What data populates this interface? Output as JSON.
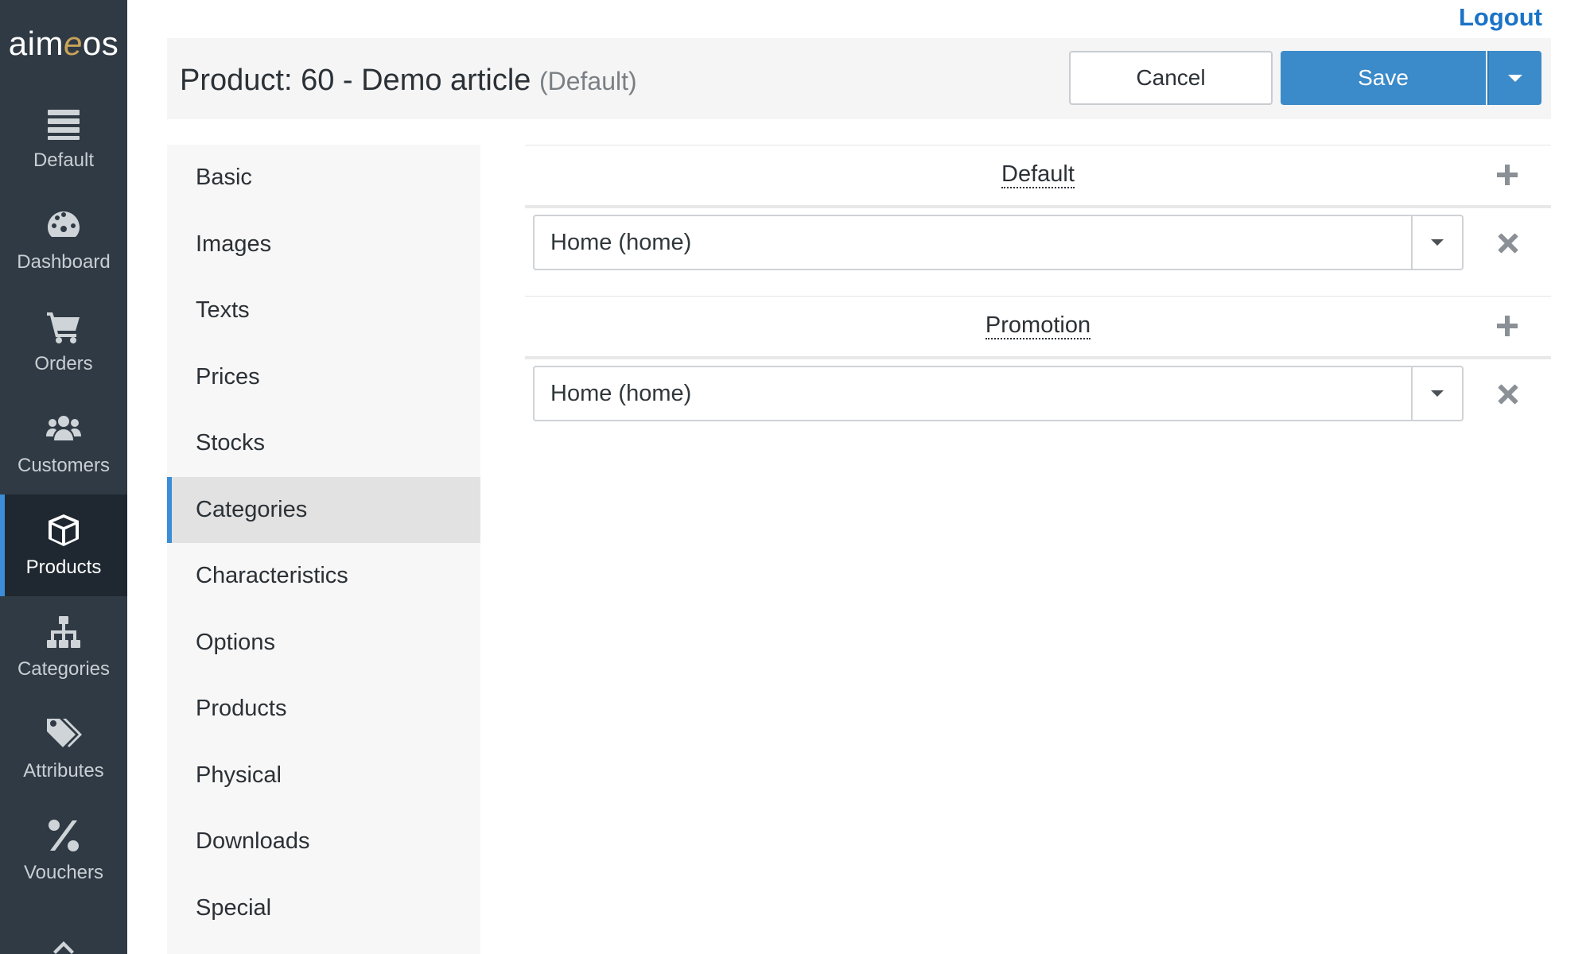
{
  "brand": {
    "logo_pre": "aim",
    "logo_e": "e",
    "logo_post": "os"
  },
  "sidebar": {
    "items": [
      {
        "label": "Default",
        "icon": "server-icon"
      },
      {
        "label": "Dashboard",
        "icon": "dashboard-icon"
      },
      {
        "label": "Orders",
        "icon": "cart-icon"
      },
      {
        "label": "Customers",
        "icon": "users-icon"
      },
      {
        "label": "Products",
        "icon": "box-icon",
        "active": true
      },
      {
        "label": "Categories",
        "icon": "sitemap-icon"
      },
      {
        "label": "Attributes",
        "icon": "tags-icon"
      },
      {
        "label": "Vouchers",
        "icon": "percent-icon"
      }
    ]
  },
  "topbar": {
    "logout_label": "Logout"
  },
  "header": {
    "title": "Product: 60 - Demo article",
    "site": "(Default)",
    "cancel_label": "Cancel",
    "save_label": "Save"
  },
  "tabs": [
    "Basic",
    "Images",
    "Texts",
    "Prices",
    "Stocks",
    "Categories",
    "Characteristics",
    "Options",
    "Products",
    "Physical",
    "Downloads",
    "Special"
  ],
  "active_tab": "Categories",
  "groups": [
    {
      "title": "Default",
      "rows": [
        {
          "value": "Home (home)"
        }
      ]
    },
    {
      "title": "Promotion",
      "rows": [
        {
          "value": "Home (home)"
        }
      ]
    }
  ],
  "colors": {
    "accent": "#3a8dd6",
    "save": "#3b8ac9",
    "sidebar": "#303a44",
    "logout": "#1a73c7"
  }
}
